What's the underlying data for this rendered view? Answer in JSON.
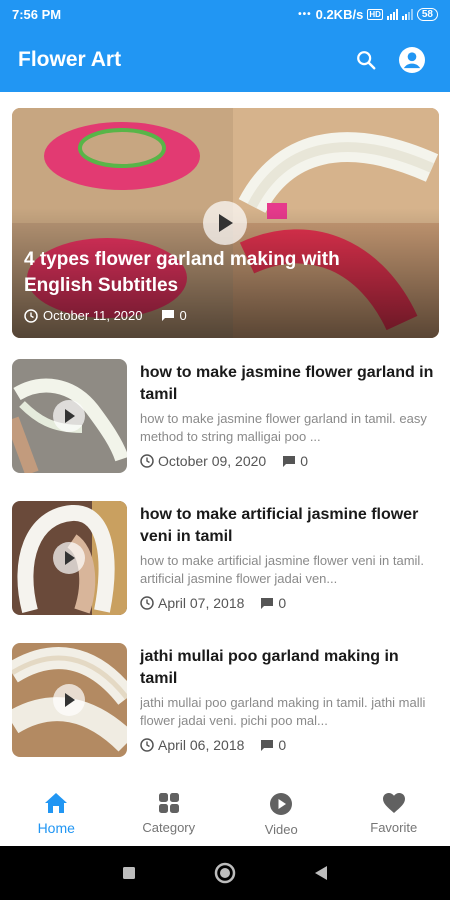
{
  "status_bar": {
    "time": "7:56 PM",
    "network_speed": "0.2KB/s",
    "battery": "58"
  },
  "app_bar": {
    "title": "Flower Art",
    "icons": [
      "search-icon",
      "account-icon"
    ]
  },
  "featured": {
    "title": "4 types flower garland making with English Subtitles",
    "date": "October 11, 2020",
    "comments": "0"
  },
  "videos": [
    {
      "title": "how to make jasmine flower garland in tamil",
      "description": "how to make jasmine flower garland in tamil. easy method to string malligai poo ...",
      "date": "October 09, 2020",
      "comments": "0"
    },
    {
      "title": "how to make artificial jasmine flower veni in tamil",
      "description": "how to make artificial jasmine flower veni in tamil. artificial jasmine flower jadai ven...",
      "date": "April 07, 2018",
      "comments": "0"
    },
    {
      "title": "jathi mullai poo garland making in tamil",
      "description": "jathi mullai poo garland making in tamil. jathi malli flower jadai veni. pichi poo mal...",
      "date": "April 06, 2018",
      "comments": "0"
    }
  ],
  "bottom_nav": {
    "items": [
      {
        "label": "Home",
        "icon": "home-icon",
        "active": true
      },
      {
        "label": "Category",
        "icon": "category-icon",
        "active": false
      },
      {
        "label": "Video",
        "icon": "video-icon",
        "active": false
      },
      {
        "label": "Favorite",
        "icon": "favorite-icon",
        "active": false
      }
    ]
  },
  "colors": {
    "primary": "#2196f3",
    "text_dark": "#1a1a1a",
    "text_muted": "#8a8a8a"
  }
}
